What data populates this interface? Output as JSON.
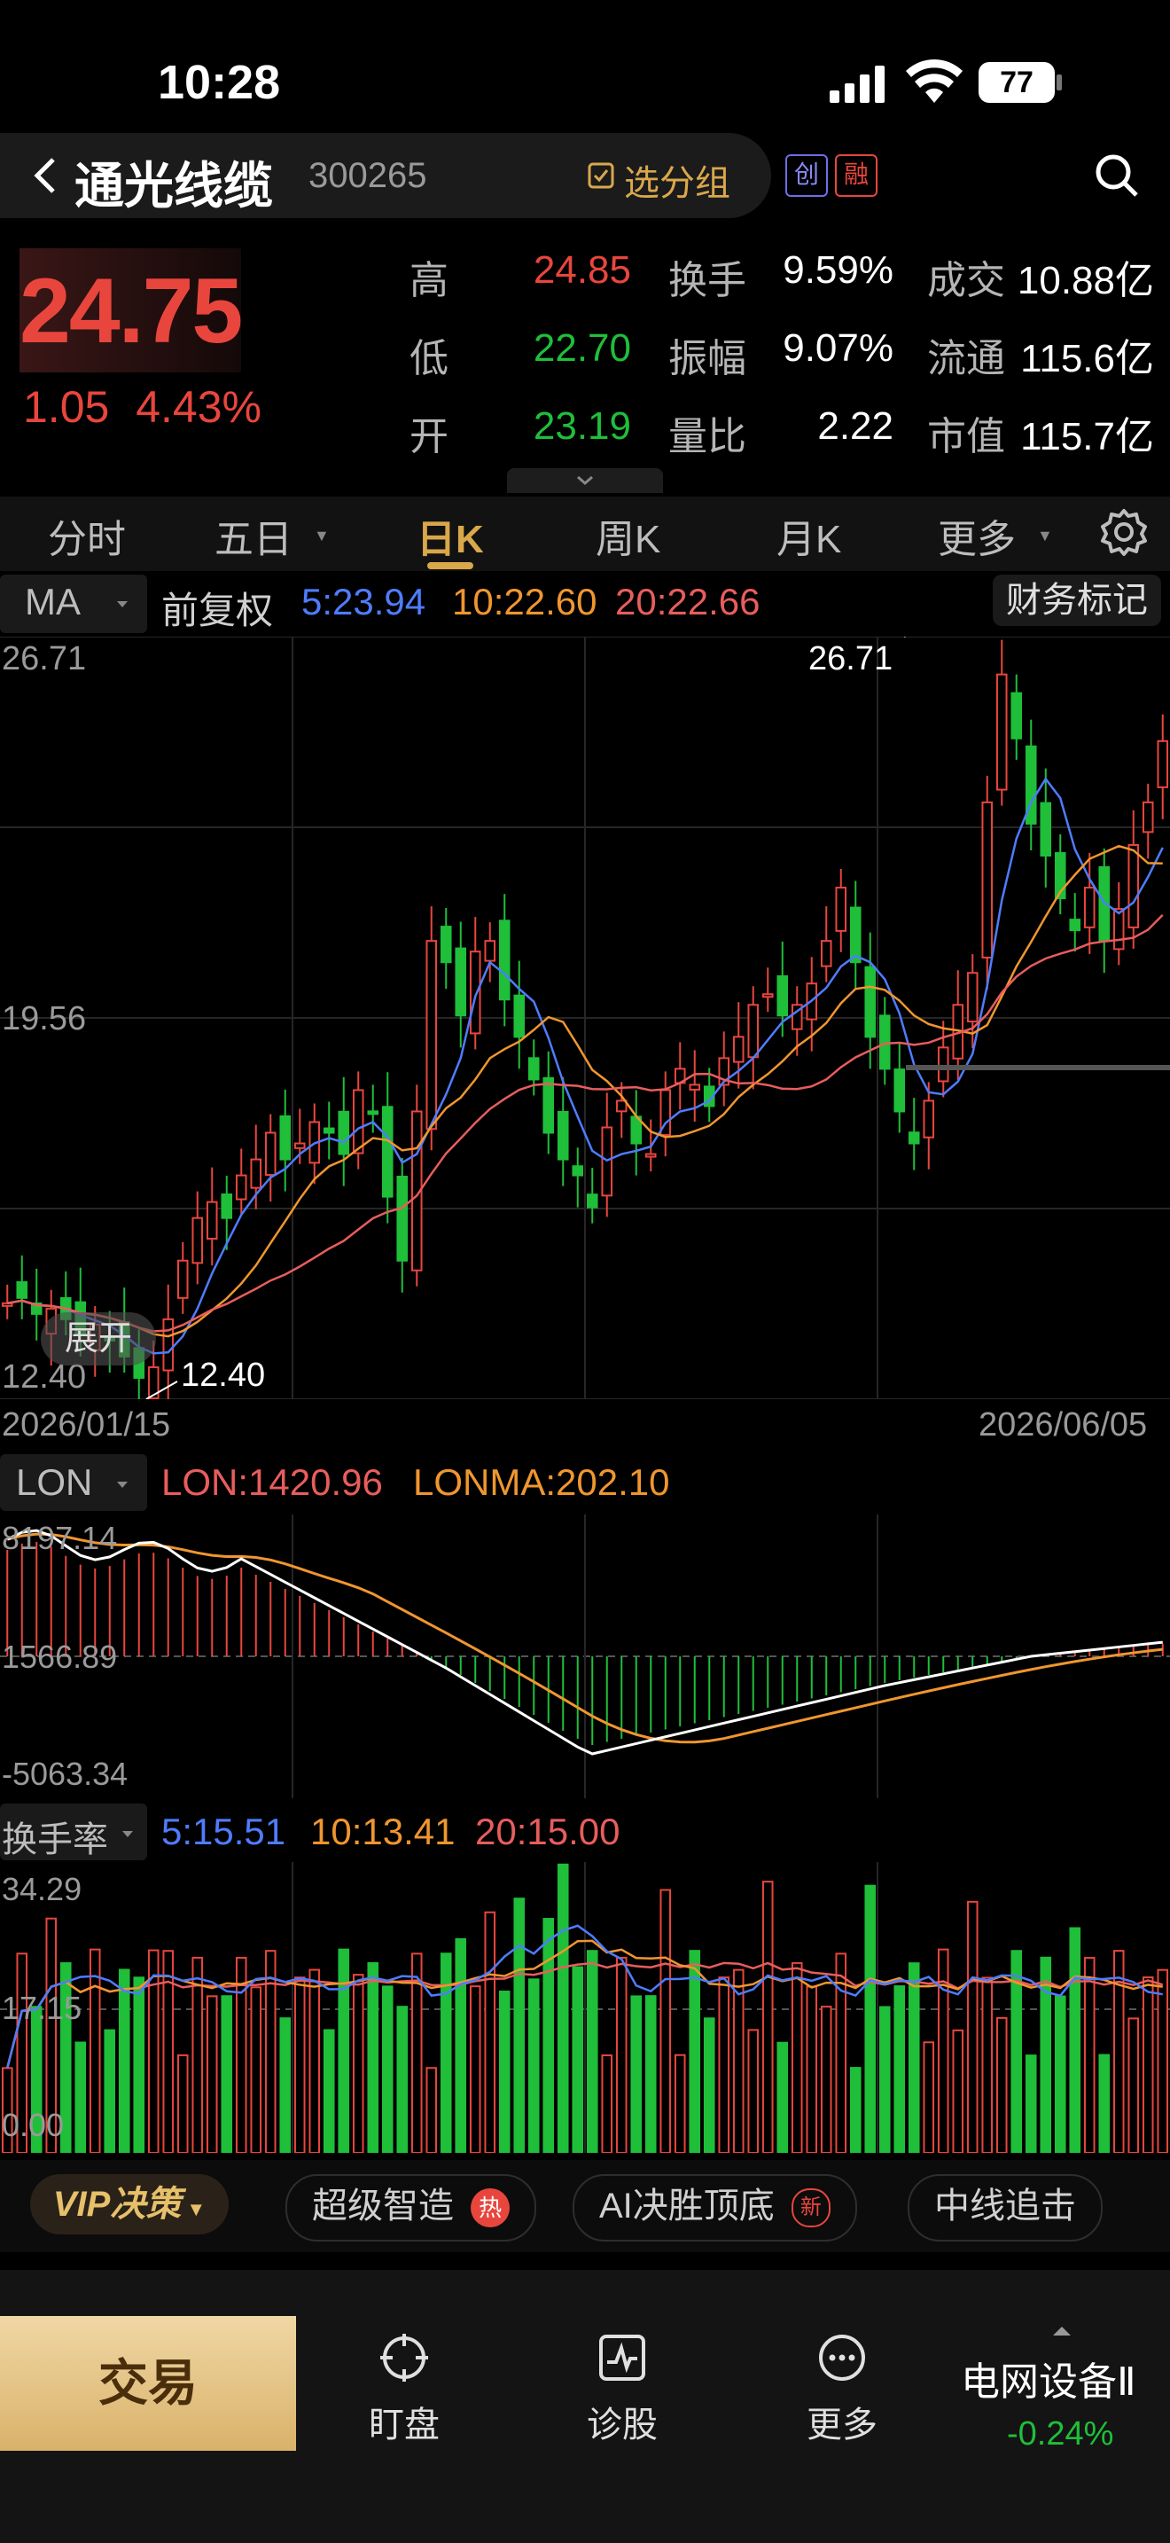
{
  "status": {
    "time": "10:28",
    "battery": "77"
  },
  "header": {
    "name": "通光线缆",
    "code": "300265",
    "watchlist": "选分组",
    "badges": [
      "创",
      "融"
    ]
  },
  "quote": {
    "price": "24.75",
    "change": "1.05",
    "change_pct": "4.43%",
    "stats": [
      {
        "label": "高",
        "value": "24.85",
        "color": "red"
      },
      {
        "label": "换手",
        "value": "9.59%",
        "color": "white"
      },
      {
        "label": "成交",
        "value": "10.88亿",
        "color": "white"
      },
      {
        "label": "低",
        "value": "22.70",
        "color": "green"
      },
      {
        "label": "振幅",
        "value": "9.07%",
        "color": "white"
      },
      {
        "label": "流通",
        "value": "115.6亿",
        "color": "white"
      },
      {
        "label": "开",
        "value": "23.19",
        "color": "green"
      },
      {
        "label": "量比",
        "value": "2.22",
        "color": "white"
      },
      {
        "label": "市值",
        "value": "115.7亿",
        "color": "white"
      }
    ]
  },
  "tabs": [
    "分时",
    "五日",
    "日K",
    "周K",
    "月K",
    "更多"
  ],
  "active_tab": "日K",
  "main_chart": {
    "indicator": "MA",
    "adjust": "前复权",
    "ma5": "5:23.94",
    "ma10": "10:22.60",
    "ma20": "20:22.66",
    "fin_mark": "财务标记",
    "y_top": "26.71",
    "y_mid": "19.56",
    "y_bottom": "12.40",
    "max_label": "26.71",
    "min_label": "12.40",
    "date_start": "2026/01/15",
    "date_end": "2026/06/05",
    "expand": "展开"
  },
  "lon_chart": {
    "indicator": "LON",
    "lon": "LON:1420.96",
    "lonma": "LONMA:202.10",
    "y_top": "8197.14",
    "y_mid": "1566.89",
    "y_bottom": "-5063.34"
  },
  "turnover_chart": {
    "indicator": "换手率",
    "ma5": "5:15.51",
    "ma10": "10:13.41",
    "ma20": "20:15.00",
    "y_top": "34.29",
    "y_mid": "17.15",
    "y_bottom": "0.00"
  },
  "strategies": [
    {
      "label": "VIP决策"
    },
    {
      "label": "超级智造",
      "badge": "热"
    },
    {
      "label": "AI决胜顶底",
      "badge": "新"
    },
    {
      "label": "中线追击"
    }
  ],
  "bottom_nav": {
    "trade": "交易",
    "items": [
      "盯盘",
      "诊股",
      "更多"
    ],
    "sector": "电网设备Ⅱ",
    "sector_change": "-0.24%"
  },
  "colors": {
    "up": "#e8463d",
    "down": "#1fbf3a",
    "ma5": "#4f7cff",
    "ma10": "#f0962f",
    "ma20": "#e85d5d"
  }
}
